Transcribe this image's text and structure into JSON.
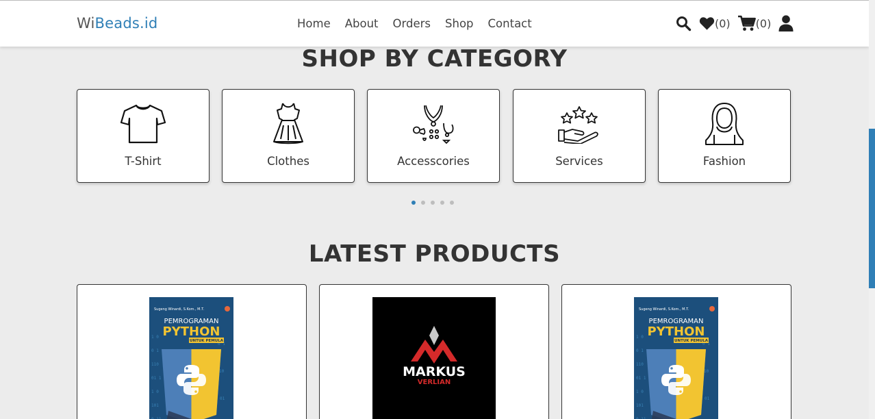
{
  "brand": {
    "prefix": "Wi",
    "accent": "Beads.id"
  },
  "nav": {
    "links": [
      "Home",
      "About",
      "Orders",
      "Shop",
      "Contact"
    ]
  },
  "header_icons": {
    "wishlist_count": "(0)",
    "cart_count": "(0)"
  },
  "categories_section": {
    "title": "SHOP BY CATEGORY",
    "items": [
      {
        "label": "T-Shirt",
        "icon": "tshirt-icon"
      },
      {
        "label": "Clothes",
        "icon": "dress-icon"
      },
      {
        "label": "Accesscories",
        "icon": "jewelry-icon"
      },
      {
        "label": "Services",
        "icon": "stars-hand-icon"
      },
      {
        "label": "Fashion",
        "icon": "hijab-woman-icon"
      }
    ],
    "carousel_page": 1,
    "carousel_pages": 5
  },
  "latest_section": {
    "title": "LATEST PRODUCTS",
    "products": [
      {
        "cover": {
          "author": "Sugeng Winardi, S.Kom., M.T.",
          "line1": "PEMROGRAMAN",
          "line2": "PYTHON",
          "line3": "UNTUK PEMULA"
        }
      },
      {
        "cover": {
          "line1": "MARKUS",
          "line2": "VERLIAN"
        }
      },
      {
        "cover": {
          "author": "Sugeng Winardi, S.Kom., M.T.",
          "line1": "PEMROGRAMAN",
          "line2": "PYTHON",
          "line3": "UNTUK PEMULA"
        }
      }
    ]
  },
  "colors": {
    "accent": "#2f7fb6",
    "page_bg": "#ececec",
    "python_yellow": "#f2c431",
    "logo_red": "#d42a2a"
  }
}
